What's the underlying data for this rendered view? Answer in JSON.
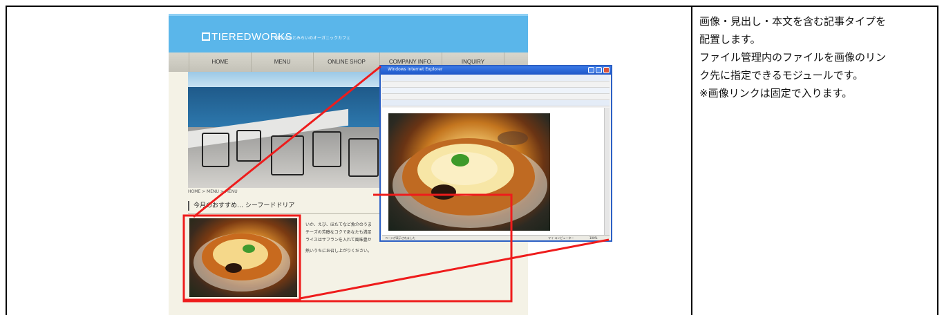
{
  "description": [
    "画像・見出し・本文を含む記事タイプを",
    "配置します。",
    "ファイル管理内のファイルを画像のリン",
    "ク先に指定できるモジュールです。",
    "※画像リンクは固定で入ります。"
  ],
  "site": {
    "logo_text": "TIEREDWORKS",
    "tagline": "横浜みなとみらいのオーガニックカフェ",
    "nav": [
      "HOME",
      "MENU",
      "ONLINE SHOP",
      "COMPANY INFO.",
      "INQUIRY"
    ],
    "breadcrumb": "HOME > MENU > MENU",
    "article_title": "今月のおすすめ… シーフードドリア",
    "article_text": [
      "いか、えび、ほたてなど魚介のうまみが",
      "チーズの芳醇なコクであなたも満足。",
      "ライスはサフランを入れて風味豊かに仕"
    ],
    "article_closing": "熱いうちにお召し上がりください。"
  },
  "popup": {
    "title": "Windows Internet Explorer",
    "status_left": "ページが表示されました",
    "status_right": "マイ コンピューター",
    "zoom": "100%"
  },
  "colors": {
    "header_blue": "#5ab6ea",
    "highlight_red": "#ee1c1c",
    "popup_blue": "#2b5fc4"
  }
}
